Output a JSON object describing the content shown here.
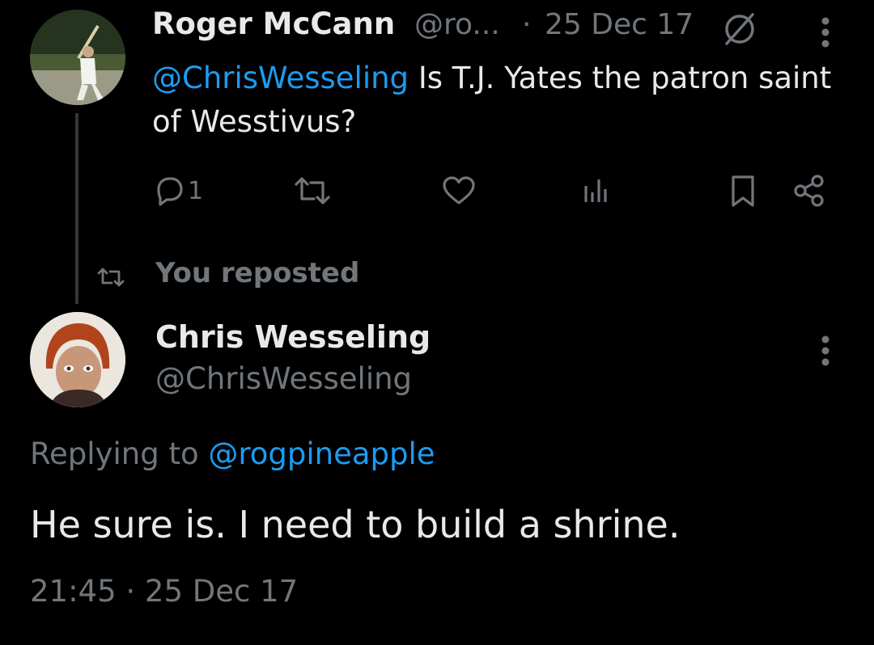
{
  "parent_tweet": {
    "author_name": "Roger McCann",
    "author_handle": "@ro...",
    "separator": "·",
    "date": "25 Dec 17",
    "mention": "@ChrisWesseling",
    "text": " Is T.J. Yates the patron saint of Wesstivus?",
    "reply_count": "1"
  },
  "repost_notice": {
    "label": "You reposted"
  },
  "main_tweet": {
    "author_name": "Chris Wesseling",
    "author_handle": "@ChrisWesseling",
    "replying_prefix": "Replying to ",
    "replying_handle": "@rogpineapple",
    "text": "He sure is. I need to build a shrine.",
    "timestamp": "21:45 · 25 Dec 17"
  },
  "colors": {
    "background": "#000000",
    "text": "#e7e9ea",
    "muted": "#71767b",
    "link": "#1d9bf0",
    "thread_line": "#333639"
  },
  "icons": [
    "mute-icon",
    "more-icon",
    "reply-icon",
    "repost-icon",
    "like-icon",
    "views-icon",
    "bookmark-icon",
    "share-icon"
  ]
}
